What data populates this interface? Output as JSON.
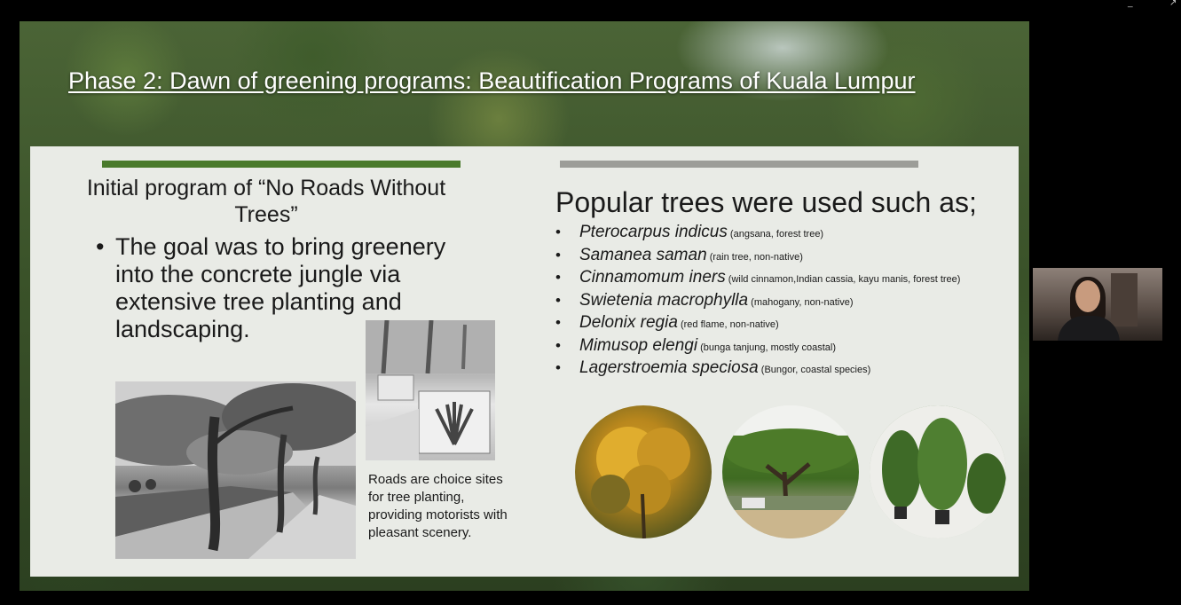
{
  "slide": {
    "title": "Phase 2: Dawn of greening programs: Beautification Programs of Kuala Lumpur",
    "left": {
      "heading": "Initial program of “No Roads Without Trees”",
      "bullet": "The goal was to bring greenery into the concrete jungle via extensive tree planting and landscaping.",
      "caption": "Roads are choice sites for tree planting, providing motorists with pleasant scenery."
    },
    "right": {
      "heading": "Popular trees were used such as;",
      "trees": [
        {
          "name": "Pterocarpus indicus",
          "note": " (angsana, forest tree)"
        },
        {
          "name": "Samanea saman",
          "note": " (rain tree, non-native)"
        },
        {
          "name": "Cinnamomum iners",
          "note": " (wild cinnamon,Indian cassia, kayu manis, forest tree)"
        },
        {
          "name": "Swietenia macrophylla",
          "note": " (mahogany, non-native)"
        },
        {
          "name": "Delonix regia",
          "note": " (red flame, non-native)"
        },
        {
          "name": "Mimusop elengi",
          "note": " (bunga tanjung, mostly coastal)"
        },
        {
          "name": "Lagerstroemia speciosa",
          "note": " (Bungor, coastal species)"
        }
      ]
    }
  },
  "window_controls": {
    "minimize": "_",
    "maximize": "↗"
  },
  "colors": {
    "left_accent": "#4a7a2c",
    "right_accent": "#9c9d98",
    "panel": "#e9ebe6"
  }
}
